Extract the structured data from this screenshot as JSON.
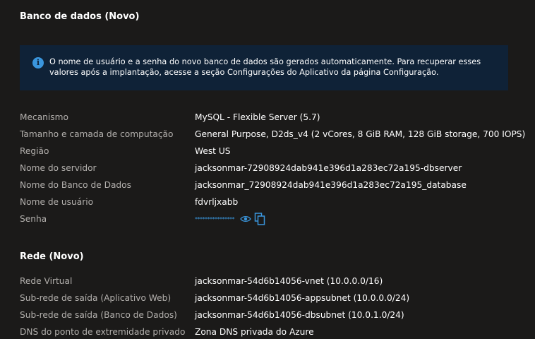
{
  "database": {
    "title": "Banco de dados (Novo)",
    "info": "O nome de usuário e a senha do novo banco de dados são gerados automaticamente. Para recuperar esses valores após a implantação, acesse a seção Configurações do Aplicativo da página Configuração.",
    "rows": [
      {
        "label": "Mecanismo",
        "value": "MySQL - Flexible Server (5.7)"
      },
      {
        "label": "Tamanho e camada de computação",
        "value": "General Purpose, D2ds_v4 (2 vCores, 8 GiB RAM, 128 GiB storage, 700 IOPS)"
      },
      {
        "label": "Região",
        "value": "West US"
      },
      {
        "label": "Nome do servidor",
        "value": "jacksonmar-72908924dab941e396d1a283ec72a195-dbserver"
      },
      {
        "label": "Nome do Banco de Dados",
        "value": "jacksonmar_72908924dab941e396d1a283ec72a195_database"
      },
      {
        "label": "Nome de usuário",
        "value": "fdvrljxabb"
      },
      {
        "label": "Senha",
        "value": "****************"
      }
    ]
  },
  "network": {
    "title": "Rede (Novo)",
    "rows": [
      {
        "label": "Rede Virtual",
        "value": "jacksonmar-54d6b14056-vnet (10.0.0.0/16)"
      },
      {
        "label": "Sub-rede de saída (Aplicativo Web)",
        "value": "jacksonmar-54d6b14056-appsubnet (10.0.0.0/24)"
      },
      {
        "label": "Sub-rede de saída (Banco de Dados)",
        "value": "jacksonmar-54d6b14056-dbsubnet (10.0.1.0/24)"
      },
      {
        "label": "DNS do ponto de extremidade privado",
        "value": "Zona DNS privada do Azure"
      }
    ]
  },
  "colors": {
    "accent": "#3a96dd",
    "info_background": "#0f2237",
    "page_background": "#1b1a19",
    "label_text": "#b3b0ad"
  },
  "icons": {
    "info": "info-icon",
    "reveal": "eye-icon",
    "copy": "copy-icon"
  }
}
